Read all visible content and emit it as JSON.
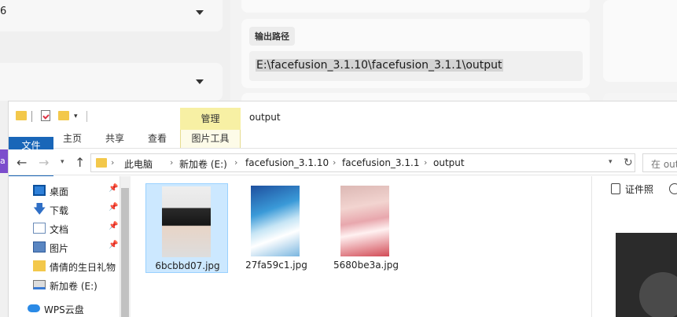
{
  "background": {
    "select1_value": "6",
    "output_label": "输出路径",
    "output_path": "E:\\facefusion_3.1.10\\facefusion_3.1.1\\output",
    "purple_fragment": "a"
  },
  "explorer": {
    "manage_tab": "管理",
    "window_title": "output",
    "ribbon_tabs": {
      "file": "文件",
      "home": "主页",
      "share": "共享",
      "view": "查看",
      "picture_tools": "图片工具"
    },
    "breadcrumbs": [
      "此电脑",
      "新加卷 (E:)",
      "facefusion_3.1.10",
      "facefusion_3.1.1",
      "output"
    ],
    "search_placeholder": "在 out",
    "nav_items": [
      {
        "label": "桌面",
        "icon": "desktop-icon",
        "pinned": true
      },
      {
        "label": "下载",
        "icon": "download-icon",
        "pinned": true
      },
      {
        "label": "文档",
        "icon": "documents-icon",
        "pinned": true
      },
      {
        "label": "图片",
        "icon": "pictures-icon",
        "pinned": true
      },
      {
        "label": "倩倩的生日礼物",
        "icon": "folder-icon",
        "pinned": false
      },
      {
        "label": "新加卷 (E:)",
        "icon": "drive-icon",
        "pinned": false
      },
      {
        "label": "WPS云盘",
        "icon": "cloud-icon",
        "pinned": false
      }
    ],
    "files": [
      {
        "name": "6bcbbd07.jpg",
        "selected": true
      },
      {
        "name": "27fa59c1.jpg",
        "selected": false
      },
      {
        "name": "5680be3a.jpg",
        "selected": false
      }
    ],
    "right_panel": {
      "id_photo_label": "证件照"
    }
  }
}
